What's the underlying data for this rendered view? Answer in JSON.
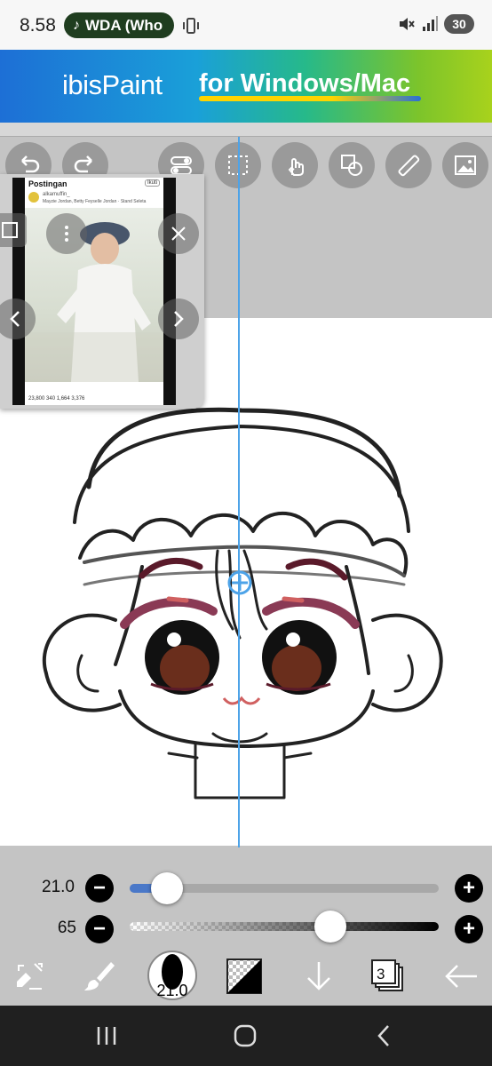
{
  "status_bar": {
    "time": "8.58",
    "media_pill": "WDA (Who",
    "battery": "30"
  },
  "banner": {
    "logo": "ibisPaint",
    "tagline": "for Windows/Mac"
  },
  "reference": {
    "header": "Postingan",
    "follow": "Ikuti",
    "username": "alkamuffin_",
    "song": "Mayzie Jordan, Betty Feyselle Jordan · Stand Seleta",
    "counts": "23,800   340   1,664   3,376"
  },
  "sliders": {
    "brush_size": {
      "label": "21.0",
      "value": 0.12
    },
    "opacity": {
      "label": "65",
      "value": 0.65
    }
  },
  "toolbar": {
    "brush_size_badge": "21.0",
    "layer_count": "3"
  },
  "colors": {
    "guide": "#4da3e8",
    "slider_fill": "#4a78c8",
    "canvas": "#ffffff",
    "ui_gray": "#c4c4c4"
  }
}
